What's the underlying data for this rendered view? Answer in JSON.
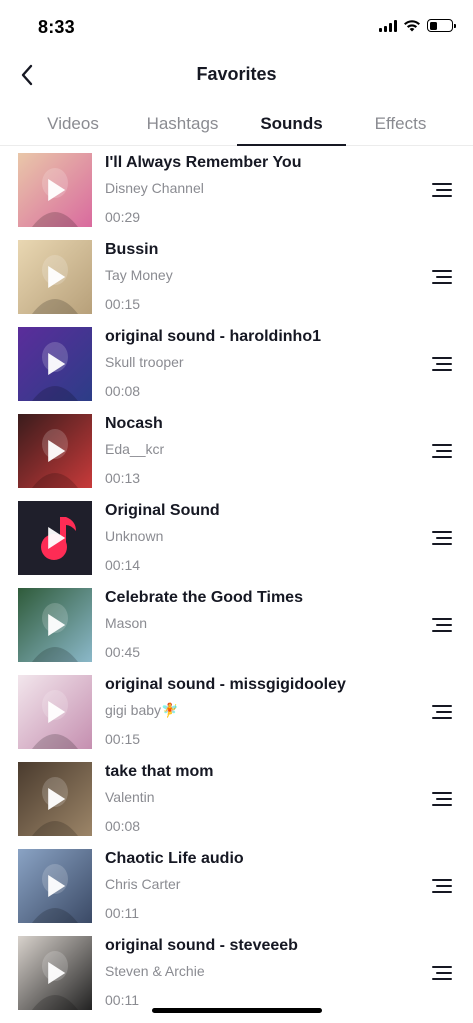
{
  "status_bar": {
    "time": "8:33",
    "icons": [
      "cellular-signal-icon",
      "wifi-icon",
      "battery-icon"
    ],
    "battery_level": 0.35
  },
  "header": {
    "title": "Favorites",
    "back_icon": "chevron-left-icon"
  },
  "tabs": [
    {
      "label": "Videos",
      "active": false
    },
    {
      "label": "Hashtags",
      "active": false
    },
    {
      "label": "Sounds",
      "active": true
    },
    {
      "label": "Effects",
      "active": false
    }
  ],
  "sounds": [
    {
      "title": "I'll Always Remember You",
      "artist": "Disney Channel",
      "duration": "00:29",
      "thumb_colors": [
        "#e9c7a9",
        "#d96a9e"
      ]
    },
    {
      "title": "Bussin",
      "artist": "Tay Money",
      "duration": "00:15",
      "thumb_colors": [
        "#e9d7b2",
        "#b7a07a"
      ]
    },
    {
      "title": "original sound - haroldinho1",
      "artist": "Skull trooper",
      "duration": "00:08",
      "thumb_colors": [
        "#5b2d9b",
        "#2c3d87"
      ]
    },
    {
      "title": "Nocash",
      "artist": "Eda__kcr",
      "duration": "00:13",
      "thumb_colors": [
        "#3a1c1c",
        "#c83a3a"
      ]
    },
    {
      "title": "Original Sound",
      "artist": "Unknown",
      "duration": "00:14",
      "thumb_colors": [
        "#1f1f2b",
        "#fe2c55"
      ]
    },
    {
      "title": "Celebrate the Good Times",
      "artist": "Mason",
      "duration": "00:45",
      "thumb_colors": [
        "#2f5b3a",
        "#8bb8c9"
      ]
    },
    {
      "title": "original sound - missgigidooley",
      "artist": "gigi baby🧚",
      "duration": "00:15",
      "thumb_colors": [
        "#f2e6ec",
        "#c58fb0"
      ]
    },
    {
      "title": "take that mom",
      "artist": "Valentin",
      "duration": "00:08",
      "thumb_colors": [
        "#4a3b2e",
        "#9c8568"
      ]
    },
    {
      "title": "Chaotic Life audio",
      "artist": "Chris Carter",
      "duration": "00:11",
      "thumb_colors": [
        "#8aa3c4",
        "#3b4a66"
      ]
    },
    {
      "title": "original sound - steveeeb",
      "artist": "Steven & Archie",
      "duration": "00:11",
      "thumb_colors": [
        "#d8d2cc",
        "#222222"
      ]
    }
  ],
  "colors": {
    "text_primary": "#161823",
    "text_secondary": "#8a8b91",
    "divider": "#ececec",
    "accent": "#fe2c55"
  }
}
